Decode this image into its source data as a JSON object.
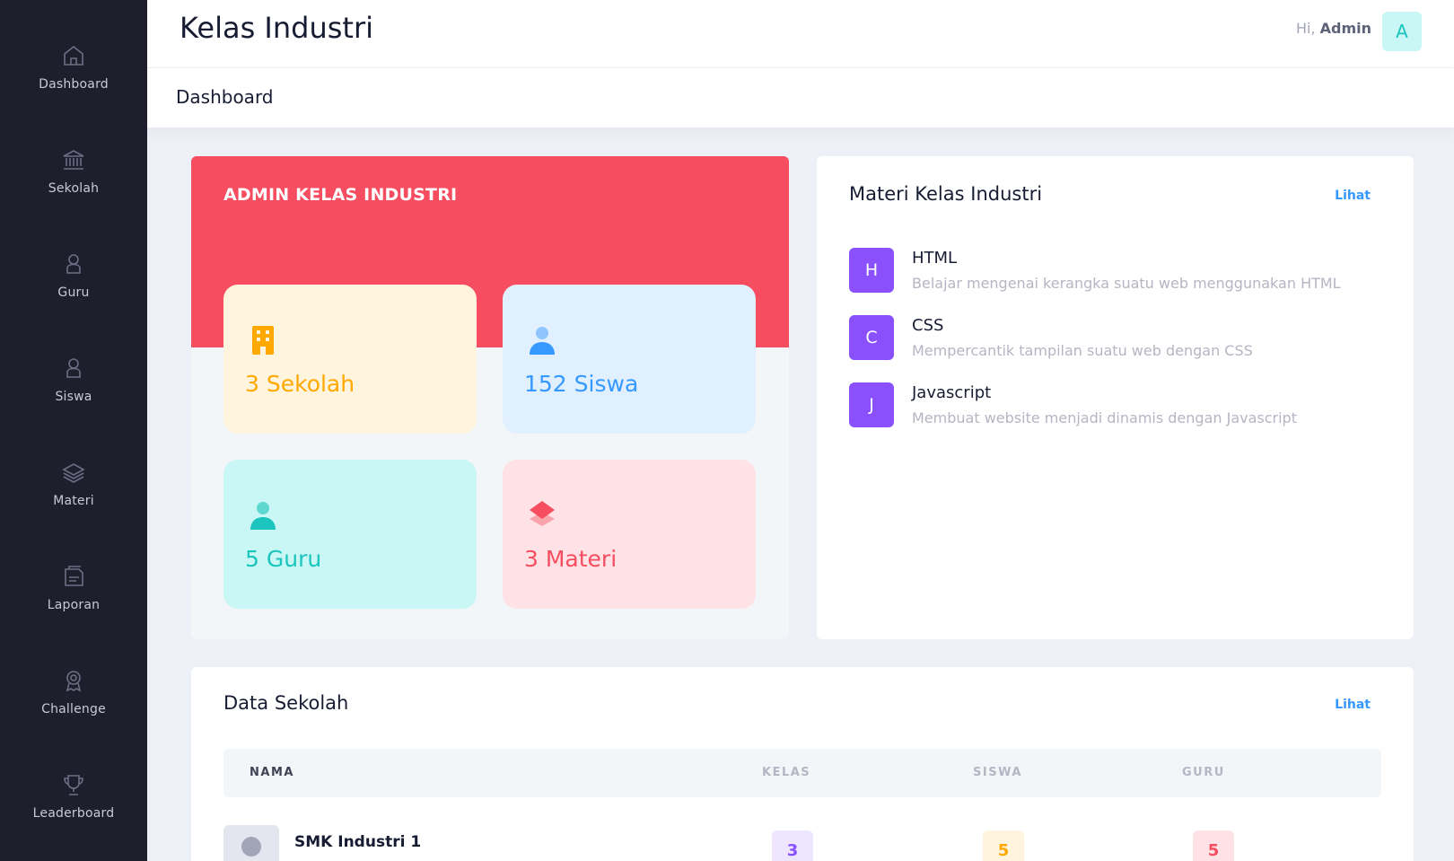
{
  "header": {
    "title": "Kelas Industri",
    "greeting_prefix": "Hi,",
    "user_name": "Admin",
    "avatar_letter": "A"
  },
  "page_title": "Dashboard",
  "sidebar": {
    "items": [
      {
        "label": "Dashboard",
        "icon": "home-icon"
      },
      {
        "label": "Sekolah",
        "icon": "bank-icon"
      },
      {
        "label": "Guru",
        "icon": "user-icon"
      },
      {
        "label": "Siswa",
        "icon": "user-icon"
      },
      {
        "label": "Materi",
        "icon": "layers-icon"
      },
      {
        "label": "Laporan",
        "icon": "document-icon"
      },
      {
        "label": "Challenge",
        "icon": "award-icon"
      },
      {
        "label": "Leaderboard",
        "icon": "trophy-icon"
      }
    ]
  },
  "admin_card": {
    "title": "ADMIN KELAS INDUSTRI",
    "stats": {
      "sekolah": "3 Sekolah",
      "siswa": "152 Siswa",
      "guru": "5 Guru",
      "materi": "3 Materi"
    },
    "colors": {
      "banner": "#f64e60",
      "sekolah": "#ffa800",
      "siswa": "#3699ff",
      "guru": "#1bc5bd",
      "materi": "#f64e60"
    }
  },
  "materi": {
    "title": "Materi Kelas Industri",
    "link": "Lihat",
    "items": [
      {
        "badge": "H",
        "name": "HTML",
        "desc": "Belajar mengenai kerangka suatu web menggunakan HTML"
      },
      {
        "badge": "C",
        "name": "CSS",
        "desc": "Mempercantik tampilan suatu web dengan CSS"
      },
      {
        "badge": "J",
        "name": "Javascript",
        "desc": "Membuat website menjadi dinamis dengan Javascript"
      }
    ]
  },
  "data_sekolah": {
    "title": "Data Sekolah",
    "link": "Lihat",
    "columns": {
      "nama": "NAMA",
      "kelas": "KELAS",
      "siswa": "SISWA",
      "guru": "GURU"
    },
    "rows": [
      {
        "nama": "SMK Industri 1",
        "kelas": "3",
        "siswa": "5",
        "guru": "5"
      }
    ]
  }
}
